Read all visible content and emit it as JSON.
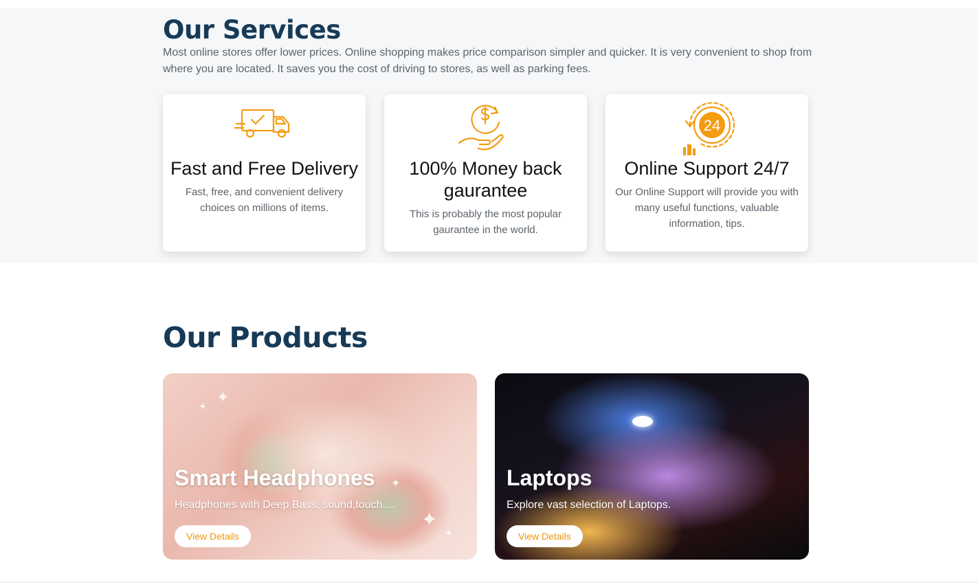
{
  "services": {
    "title": "Our Services",
    "description": "Most online stores offer lower prices. Online shopping makes price comparison simpler and quicker. It is very convenient to shop from where you are located. It saves you the cost of driving to stores, as well as parking fees.",
    "cards": [
      {
        "icon": "delivery-truck-icon",
        "title": "Fast and Free Delivery",
        "text": "Fast, free, and convenient delivery choices on millions of items."
      },
      {
        "icon": "money-back-icon",
        "title": "100% Money back gaurantee",
        "text": "This is probably the most popular gaurantee in the world."
      },
      {
        "icon": "support-24-icon",
        "icon_text": "24",
        "title": "Online Support 24/7",
        "text": "Our Online Support will provide you with many useful functions, valuable information, tips."
      }
    ]
  },
  "products": {
    "title": "Our Products",
    "items": [
      {
        "name": "Smart Headphones",
        "description": "Headphones with Deep Bass, sound,touch....",
        "button": "View Details"
      },
      {
        "name": "Laptops",
        "description": "Explore vast selection of Laptops.",
        "button": "View Details"
      }
    ]
  },
  "colors": {
    "accent": "#f39c12",
    "heading": "#173a57",
    "text_muted": "#5b636b",
    "section_bg": "#f5f7f9"
  }
}
